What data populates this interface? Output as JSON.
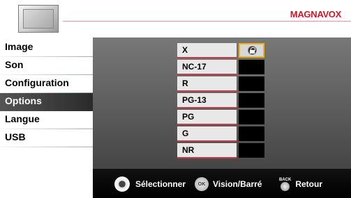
{
  "brand": "MAGNAVOX",
  "colors": {
    "accent": "#f2b11a",
    "brand_red": "#cc1a28",
    "divider": "#b8454f"
  },
  "menu": {
    "items": [
      {
        "label": "Image"
      },
      {
        "label": "Son"
      },
      {
        "label": "Configuration"
      },
      {
        "label": "Options",
        "selected": true
      },
      {
        "label": "Langue"
      },
      {
        "label": "USB"
      }
    ]
  },
  "ratings": {
    "items": [
      {
        "label": "X",
        "locked": true,
        "focused": true
      },
      {
        "label": "NC-17",
        "locked": false
      },
      {
        "label": "R",
        "locked": false
      },
      {
        "label": "PG-13",
        "locked": false
      },
      {
        "label": "PG",
        "locked": false
      },
      {
        "label": "G",
        "locked": false
      },
      {
        "label": "NR",
        "locked": false
      }
    ]
  },
  "footer": {
    "select_label": "Sélectionner",
    "ok_icon_text": "OK",
    "ok_label": "Vision/Barré",
    "back_icon_text": "BACK",
    "back_label": "Retour"
  }
}
